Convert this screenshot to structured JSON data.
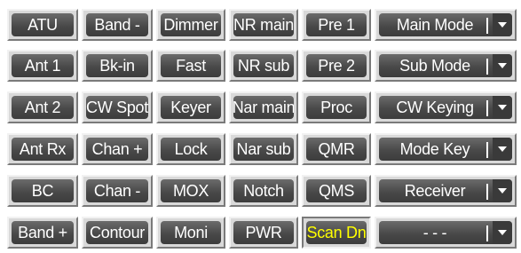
{
  "rows": [
    {
      "buttons": [
        "ATU",
        "Band -",
        "Dimmer",
        "NR main",
        "Pre 1"
      ],
      "combo": "Main Mode"
    },
    {
      "buttons": [
        "Ant 1",
        "Bk-in",
        "Fast",
        "NR sub",
        "Pre 2"
      ],
      "combo": "Sub Mode"
    },
    {
      "buttons": [
        "Ant 2",
        "CW Spot",
        "Keyer",
        "Nar main",
        "Proc"
      ],
      "combo": "CW Keying"
    },
    {
      "buttons": [
        "Ant Rx",
        "Chan +",
        "Lock",
        "Nar sub",
        "QMR"
      ],
      "combo": "Mode Key"
    },
    {
      "buttons": [
        "BC",
        "Chan -",
        "MOX",
        "Notch",
        "QMS"
      ],
      "combo": "Receiver"
    },
    {
      "buttons": [
        "Band +",
        "Contour",
        "Moni",
        "PWR",
        "Scan Dn"
      ],
      "combo": "- - -"
    }
  ],
  "active_button": "Scan Dn",
  "colors": {
    "button_face": "#494949",
    "button_text": "#ffffff",
    "active_text": "#ffff00",
    "frame": "#d9d9d9"
  },
  "icons": {
    "dropdown": "chevron-down-icon"
  }
}
